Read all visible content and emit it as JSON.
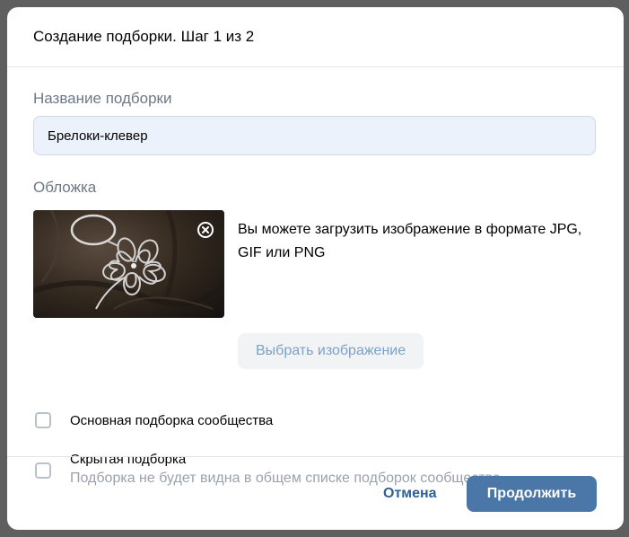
{
  "modal": {
    "title": "Создание подборки. Шаг 1 из 2"
  },
  "name_field": {
    "label": "Название подборки",
    "value": "Брелоки-клевер"
  },
  "cover": {
    "label": "Обложка",
    "info": "Вы можете загрузить изображение в формате JPG, GIF или PNG",
    "choose_button": "Выбрать изображение",
    "thumbnail_alt": "keychain-clover-image",
    "remove_icon": "close-circle-icon"
  },
  "options": {
    "main_collection": {
      "label": "Основная подборка сообщества",
      "checked": false
    },
    "hidden_collection": {
      "label": "Скрытая подборка",
      "description": "Подборка не будет видна в общем списке подборок сообщества",
      "checked": false
    }
  },
  "footer": {
    "cancel": "Отмена",
    "continue": "Продолжить"
  },
  "colors": {
    "primary": "#4a76a8",
    "link": "#2d5f99",
    "secondary_text": "#6d7885",
    "input_bg": "#ebf2fc"
  }
}
